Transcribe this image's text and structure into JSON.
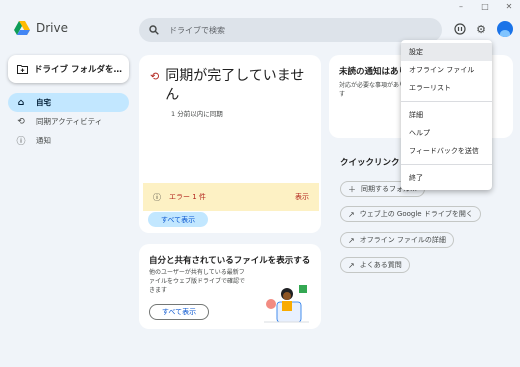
{
  "app": {
    "name": "Drive"
  },
  "search": {
    "placeholder": "ドライブで検索"
  },
  "sidebar": {
    "new_button": "ドライブ フォルダを…",
    "items": [
      {
        "label": "自宅",
        "icon": "home-icon",
        "active": true
      },
      {
        "label": "同期アクティビティ",
        "icon": "sync-icon",
        "active": false
      },
      {
        "label": "通知",
        "icon": "info-icon",
        "active": false
      }
    ]
  },
  "sync_card": {
    "title": "同期が完了していません",
    "subtitle": "1 分前以内に同期",
    "error_text": "エラー 1 件",
    "error_action": "表示",
    "show_all": "すべて表示"
  },
  "shared_card": {
    "title": "自分と共有されているファイルを表示する",
    "description": "他のユーザーが共有している最新ファイルをウェブ版ドライブで確認できます",
    "show_all": "すべて表示"
  },
  "notifications_card": {
    "title": "未読の通知はあり",
    "description": "対応が必要な事項がありす"
  },
  "quick_links": {
    "title": "クイックリンク",
    "items": [
      {
        "label": "同期するフォル…",
        "icon": "plus-icon"
      },
      {
        "label": "ウェブ上の Google ドライブを開く",
        "icon": "open-external-icon"
      },
      {
        "label": "オフライン ファイルの詳細",
        "icon": "open-external-icon"
      },
      {
        "label": "よくある質問",
        "icon": "open-external-icon"
      }
    ]
  },
  "menu": {
    "items": [
      {
        "label": "設定",
        "highlighted": true
      },
      {
        "label": "オフライン ファイル"
      },
      {
        "label": "エラーリスト"
      },
      {
        "label": "詳細"
      },
      {
        "label": "ヘルプ"
      },
      {
        "label": "フィードバックを送信"
      },
      {
        "label": "終了"
      }
    ]
  },
  "colors": {
    "background": "#f0f4f9",
    "accent_blue": "#c2e7ff",
    "error_red": "#b3261e",
    "warning_bg": "#fdf1c4"
  }
}
